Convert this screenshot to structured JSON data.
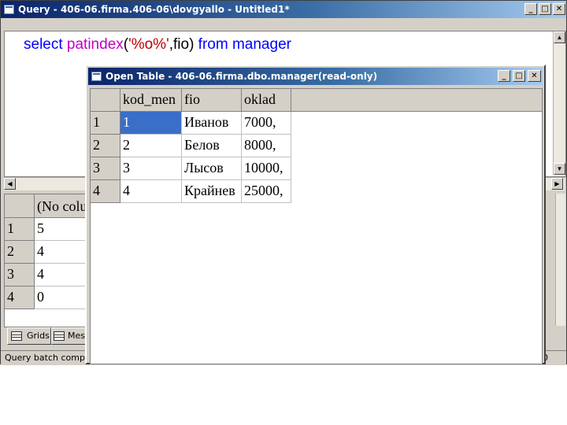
{
  "query_window": {
    "title": "Query - 406-06.firma.406-06\\dovgyallo - Untitled1*",
    "sql": {
      "kw_select": "select ",
      "fn": "patindex",
      "open_paren": "(",
      "str": "'%o%'",
      "args": ",fio)",
      "kw_from": " from ",
      "table": "manager"
    },
    "results": {
      "column_header": "(No column name)",
      "rows": [
        {
          "num": "1",
          "value": "5"
        },
        {
          "num": "2",
          "value": "4"
        },
        {
          "num": "3",
          "value": "4"
        },
        {
          "num": "4",
          "value": "0"
        }
      ]
    },
    "tabs": {
      "grids": "Grids",
      "messages": "Messages"
    },
    "status": "Query batch completed",
    "status_right": "0"
  },
  "table_window": {
    "title": "Open Table - 406-06.firma.dbo.manager(read-only)",
    "columns": [
      "kod_men",
      "fio",
      "oklad"
    ],
    "rows": [
      {
        "num": "1",
        "kod_men": "1",
        "fio": "Иванов",
        "oklad": "7000,"
      },
      {
        "num": "2",
        "kod_men": "2",
        "fio": "Белов",
        "oklad": "8000,"
      },
      {
        "num": "3",
        "kod_men": "3",
        "fio": "Лысов",
        "oklad": "10000,"
      },
      {
        "num": "4",
        "kod_men": "4",
        "fio": "Крайнев",
        "oklad": "25000,"
      }
    ]
  },
  "buttons": {
    "minimize": "_",
    "maximize": "□",
    "close": "✕"
  },
  "colors": {
    "title_start": "#0a246a",
    "title_end": "#a6caf0",
    "keyword": "#0000ff",
    "function": "#c000c0",
    "string": "#c00000",
    "selection": "#3a6ec8"
  }
}
